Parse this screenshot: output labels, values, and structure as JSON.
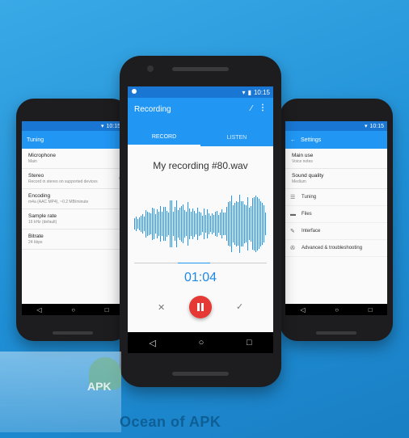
{
  "left_phone": {
    "status_time": "10:15",
    "title": "Tuning",
    "items": [
      {
        "title": "Microphone",
        "sub": "Main"
      },
      {
        "title": "Stereo",
        "sub": "Record in stereo on supported devices"
      },
      {
        "title": "Encoding",
        "sub": "m4a (AAC MP4), ~0.2 MB/minute"
      },
      {
        "title": "Sample rate",
        "sub": "16 kHz (default)"
      },
      {
        "title": "Bitrate",
        "sub": "24 kbps"
      }
    ]
  },
  "center_phone": {
    "status_time": "10:15",
    "title": "Recording",
    "tabs": [
      "RECORD",
      "LISTEN"
    ],
    "file_name": "My recording #80.wav",
    "timer": "01:04",
    "colors": {
      "primary": "#2196f3",
      "record": "#e53935"
    }
  },
  "right_phone": {
    "status_time": "10:15",
    "title": "Settings",
    "items": [
      {
        "title": "Main use",
        "sub": "Voice notes"
      },
      {
        "title": "Sound quality",
        "sub": "Medium"
      }
    ],
    "rows": [
      {
        "icon": "tune-icon",
        "label": "Tuning"
      },
      {
        "icon": "folder-icon",
        "label": "Files"
      },
      {
        "icon": "brush-icon",
        "label": "Interface"
      },
      {
        "icon": "wrench-icon",
        "label": "Advanced & troubleshooting"
      }
    ]
  },
  "watermark": {
    "text": "Ocean of APK",
    "badge": "APK"
  }
}
